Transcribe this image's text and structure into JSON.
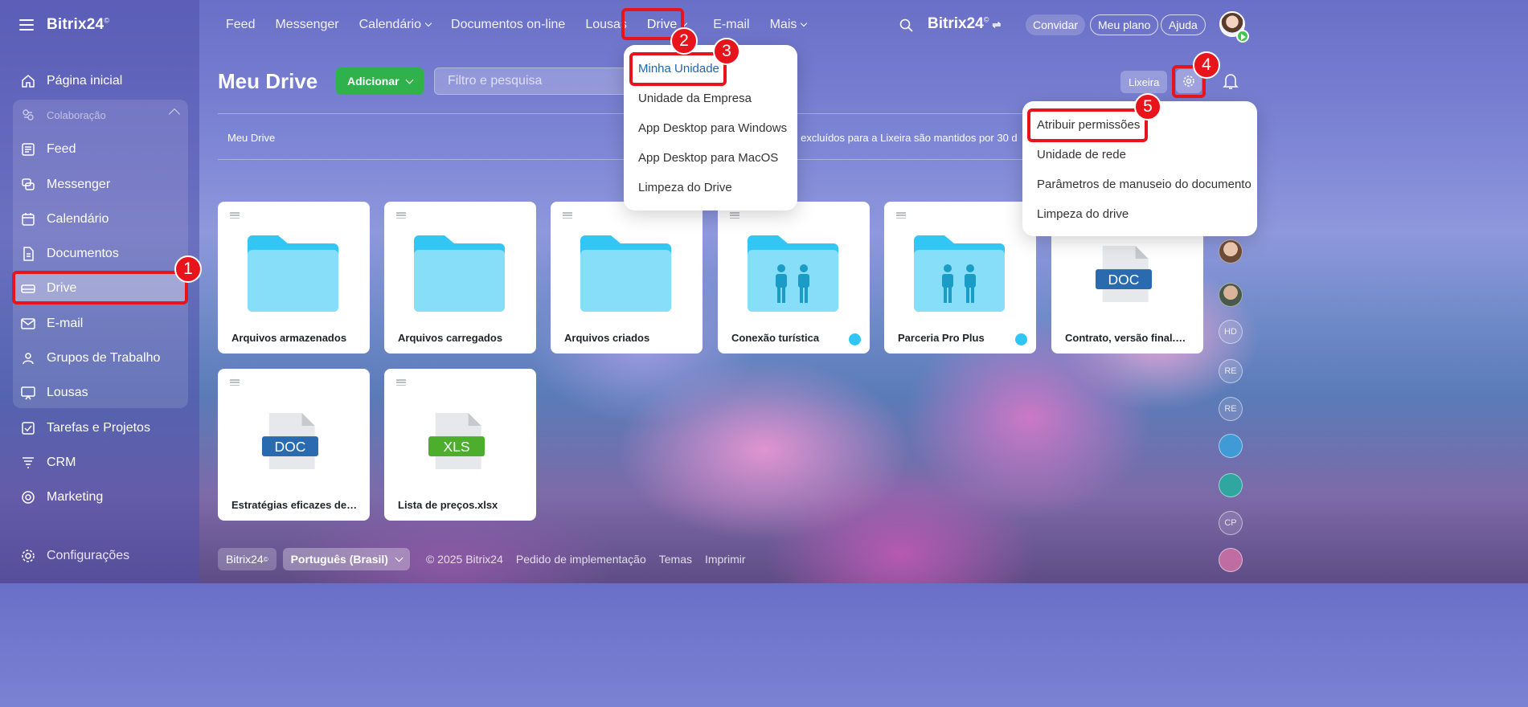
{
  "app": {
    "logo": "Bitrix24",
    "logo_mark": "©"
  },
  "sidebar": {
    "items": [
      {
        "label": "Página inicial"
      },
      {
        "label": "Colaboração"
      },
      {
        "label": "Feed"
      },
      {
        "label": "Messenger"
      },
      {
        "label": "Calendário"
      },
      {
        "label": "Documentos"
      },
      {
        "label": "Drive"
      },
      {
        "label": "E-mail"
      },
      {
        "label": "Grupos de Trabalho"
      },
      {
        "label": "Lousas"
      },
      {
        "label": "Tarefas e Projetos"
      },
      {
        "label": "CRM"
      },
      {
        "label": "Marketing"
      },
      {
        "label": "Configurações"
      }
    ]
  },
  "topnav": {
    "items": [
      "Feed",
      "Messenger",
      "Calendário",
      "Documentos on-line",
      "Lousas",
      "Drive",
      "E-mail",
      "Mais"
    ],
    "brand": "Bitrix24",
    "invite": "Convidar",
    "plan": "Meu plano",
    "help": "Ajuda"
  },
  "page": {
    "title": "Meu Drive",
    "add_button": "Adicionar",
    "search_placeholder": "Filtro e pesquisa",
    "trash_button": "Lixeira",
    "breadcrumb": "Meu Drive",
    "trash_note": "s excluídos para a Lixeira são mantidos por 30 d"
  },
  "drive_menu": {
    "items": [
      "Minha Unidade",
      "Unidade da Empresa",
      "App Desktop para Windows",
      "App Desktop para MacOS",
      "Limpeza do Drive"
    ]
  },
  "settings_menu": {
    "items": [
      "Atribuir permissões",
      "Unidade de rede",
      "Parâmetros de manuseio do documento",
      "Limpeza do drive"
    ]
  },
  "files": [
    {
      "name": "Arquivos armazenados",
      "kind": "folder"
    },
    {
      "name": "Arquivos carregados",
      "kind": "folder"
    },
    {
      "name": "Arquivos criados",
      "kind": "folder"
    },
    {
      "name": "Conexão turística",
      "kind": "shared-folder"
    },
    {
      "name": "Parceria Pro Plus",
      "kind": "shared-folder"
    },
    {
      "name": "Contrato, versão final.docx",
      "kind": "doc",
      "badge": "DOC"
    },
    {
      "name": "Estratégias eficazes de ma...",
      "kind": "doc",
      "badge": "DOC"
    },
    {
      "name": "Lista de preços.xlsx",
      "kind": "xls",
      "badge": "XLS"
    }
  ],
  "annotations": [
    "1",
    "2",
    "3",
    "4",
    "5"
  ],
  "rail": [
    "HD",
    "RE",
    "RE",
    "CP"
  ],
  "footer": {
    "brand": "Bitrix24",
    "language": "Português (Brasil)",
    "copyright": "© 2025 Bitrix24",
    "links": [
      "Pedido de implementação",
      "Temas",
      "Imprimir"
    ]
  },
  "colors": {
    "accent_green": "#2fb24c",
    "annotation_red": "#e8141c",
    "folder_blue": "#7fdbf8",
    "doc_blue": "#2a6bb0",
    "xls_green": "#4cae2c"
  }
}
